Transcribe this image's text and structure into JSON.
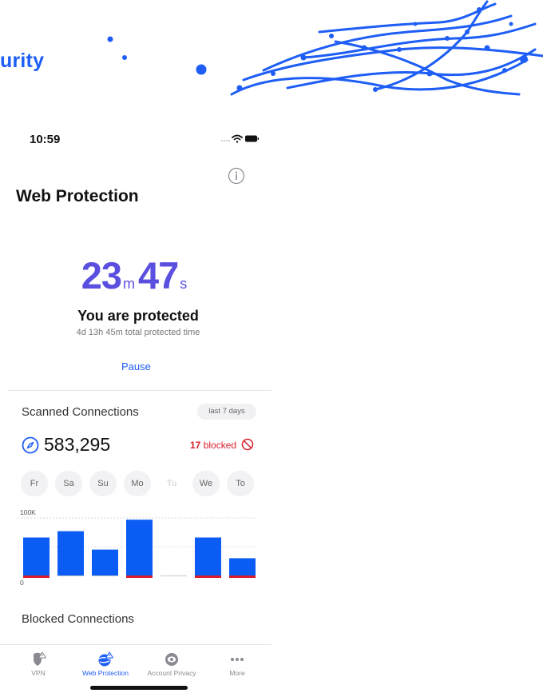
{
  "banner": {
    "word": "urity"
  },
  "status_bar": {
    "time": "10:59"
  },
  "header": {
    "title": "Web Protection"
  },
  "timer": {
    "minutes": "23",
    "minutes_unit": "m",
    "seconds": "47",
    "seconds_unit": "s"
  },
  "protection": {
    "status": "You are protected",
    "total_time": "4d 13h 45m total protected time",
    "pause_label": "Pause"
  },
  "scanned": {
    "title": "Scanned Connections",
    "period": "last 7 days",
    "count": "583,295",
    "blocked_count": "17",
    "blocked_label": "blocked"
  },
  "days": [
    "Fr",
    "Sa",
    "Su",
    "Mo",
    "Tu",
    "We",
    "To"
  ],
  "chart_data": {
    "type": "bar",
    "categories": [
      "Fr",
      "Sa",
      "Su",
      "Mo",
      "Tu",
      "We",
      "To"
    ],
    "series": [
      {
        "values": [
          66000,
          77000,
          45000,
          97000,
          0,
          66000,
          30000
        ]
      },
      {
        "values": [
          1,
          0,
          0,
          1,
          0,
          1,
          1
        ]
      }
    ],
    "tick_labels": [
      "100K",
      "0"
    ],
    "ylim": [
      0,
      100000
    ],
    "grid": true,
    "colors": {
      "scanned": "#0b5cf4",
      "blocked": "#d81e2c",
      "empty": "#c8c8cc"
    }
  },
  "blocked_section": {
    "title": "Blocked Connections"
  },
  "tabs": [
    {
      "label": "VPN",
      "icon": "vpn-shield-icon"
    },
    {
      "label": "Web Protection",
      "icon": "web-protection-globe-icon"
    },
    {
      "label": "Account Privacy",
      "icon": "account-privacy-eye-icon"
    },
    {
      "label": "More",
      "icon": "more-dots-icon"
    }
  ],
  "colors": {
    "accent": "#1e5ef5",
    "timer": "#5b4fe0",
    "danger": "#d81e2c"
  }
}
